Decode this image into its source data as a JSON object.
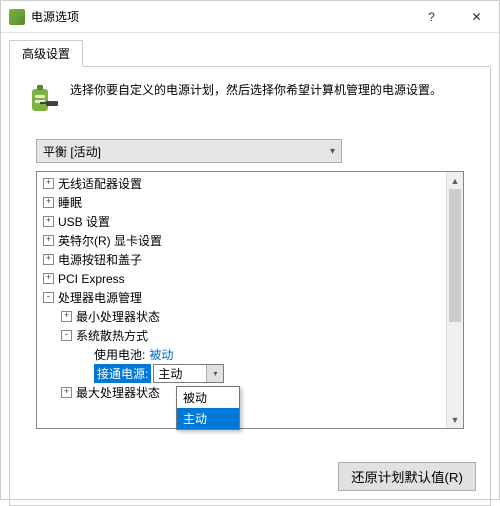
{
  "window": {
    "title": "电源选项",
    "icon": "power-plan-icon"
  },
  "tabs": {
    "advanced": "高级设置"
  },
  "header": {
    "text": "选择你要自定义的电源计划，然后选择你希望计算机管理的电源设置。"
  },
  "plan_select": {
    "selected": "平衡 [活动]"
  },
  "tree": {
    "items": [
      {
        "expander": "+",
        "indent": 0,
        "label": "无线适配器设置"
      },
      {
        "expander": "+",
        "indent": 0,
        "label": "睡眠"
      },
      {
        "expander": "+",
        "indent": 0,
        "label": "USB 设置"
      },
      {
        "expander": "+",
        "indent": 0,
        "label": "英特尔(R) 显卡设置"
      },
      {
        "expander": "+",
        "indent": 0,
        "label": "电源按钮和盖子"
      },
      {
        "expander": "+",
        "indent": 0,
        "label": "PCI Express"
      },
      {
        "expander": "-",
        "indent": 0,
        "label": "处理器电源管理"
      },
      {
        "expander": "+",
        "indent": 1,
        "label": "最小处理器状态"
      },
      {
        "expander": "-",
        "indent": 1,
        "label": "系统散热方式"
      },
      {
        "expander": "",
        "indent": 2,
        "label": "使用电池:",
        "value": "被动",
        "is_leaf": true
      },
      {
        "expander": "",
        "indent": 2,
        "label": "接通电源:",
        "value": "主动",
        "is_leaf": true,
        "selected": true,
        "combo": true
      },
      {
        "expander": "+",
        "indent": 1,
        "label": "最大处理器状态"
      }
    ]
  },
  "dropdown": {
    "options": [
      {
        "label": "被动",
        "hl": false
      },
      {
        "label": "主动",
        "hl": true
      }
    ]
  },
  "buttons": {
    "restore_defaults": "还原计划默认值(R)"
  }
}
